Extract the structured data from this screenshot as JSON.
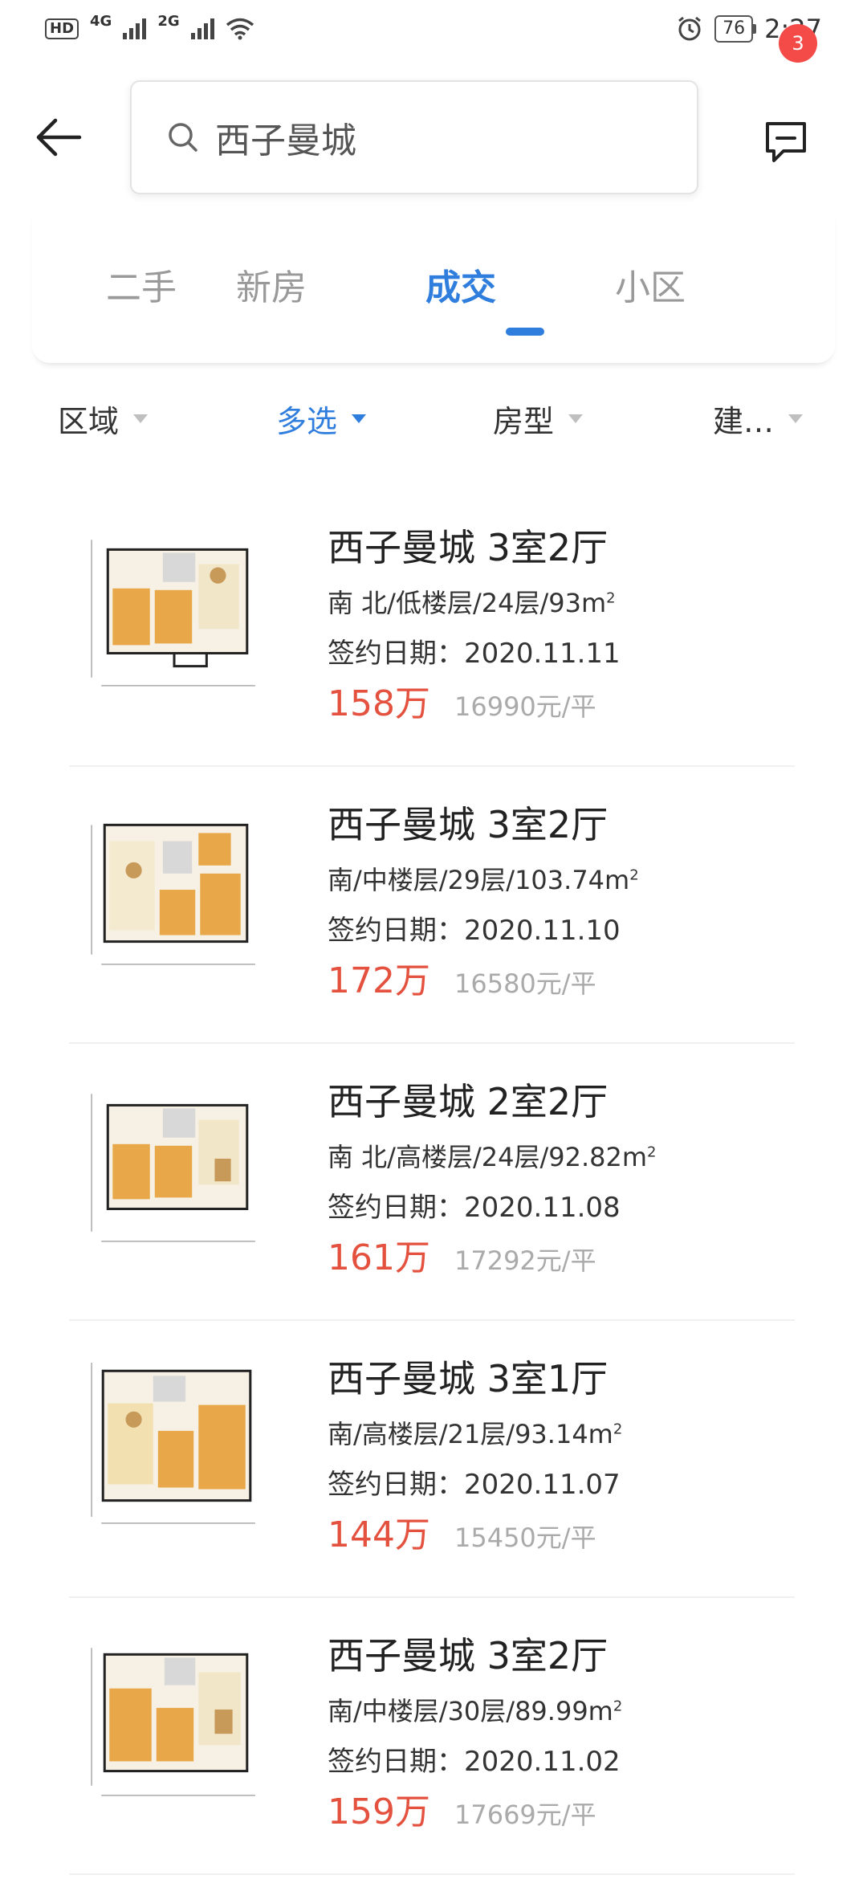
{
  "status": {
    "hd": "HD",
    "net1": "4G",
    "net2": "2G",
    "battery": "76",
    "time": "2:27"
  },
  "search": {
    "value": "西子曼城"
  },
  "messages": {
    "badge": "3"
  },
  "tabs": [
    {
      "label": "二手",
      "active": false
    },
    {
      "label": "新房",
      "active": false
    },
    {
      "label": "成交",
      "active": true
    },
    {
      "label": "小区",
      "active": false
    }
  ],
  "filters": [
    {
      "label": "区域",
      "active": false
    },
    {
      "label": "多选",
      "active": true
    },
    {
      "label": "房型",
      "active": false
    },
    {
      "label": "建…",
      "active": false
    }
  ],
  "listings": [
    {
      "title": "西子曼城 3室2厅",
      "spec": "南 北/低楼层/24层/93m",
      "date": "签约日期：2020.11.11",
      "price": "158万",
      "unit_price": "16990元/平"
    },
    {
      "title": "西子曼城 3室2厅",
      "spec": "南/中楼层/29层/103.74m",
      "date": "签约日期：2020.11.10",
      "price": "172万",
      "unit_price": "16580元/平"
    },
    {
      "title": "西子曼城 2室2厅",
      "spec": "南 北/高楼层/24层/92.82m",
      "date": "签约日期：2020.11.08",
      "price": "161万",
      "unit_price": "17292元/平"
    },
    {
      "title": "西子曼城 3室1厅",
      "spec": "南/高楼层/21层/93.14m",
      "date": "签约日期：2020.11.07",
      "price": "144万",
      "unit_price": "15450元/平"
    },
    {
      "title": "西子曼城 3室2厅",
      "spec": "南/中楼层/30层/89.99m",
      "date": "签约日期：2020.11.02",
      "price": "159万",
      "unit_price": "17669元/平"
    }
  ],
  "colors": {
    "accent": "#2f7ddc",
    "price": "#e4513e",
    "badge": "#f44b48"
  }
}
